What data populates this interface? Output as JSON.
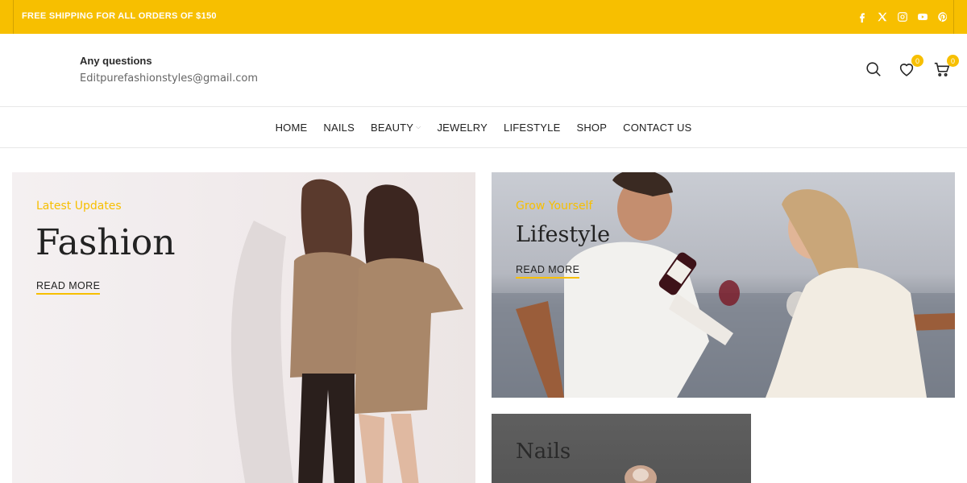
{
  "topbar": {
    "shipping_text": "FREE SHIPPING FOR ALL ORDERS OF $150",
    "bg_color": "#f7bf00",
    "socials": [
      "facebook-icon",
      "x-icon",
      "instagram-icon",
      "youtube-icon",
      "pinterest-icon"
    ]
  },
  "header": {
    "contact_label": "Any questions",
    "contact_email": "Editpurefashionstyles@gmail.com",
    "wishlist_count": "0",
    "cart_count": "0"
  },
  "nav": {
    "items": [
      {
        "label": "HOME"
      },
      {
        "label": "NAILS"
      },
      {
        "label": "BEAUTY",
        "has_dropdown": true
      },
      {
        "label": "JEWELRY"
      },
      {
        "label": "LIFESTYLE"
      },
      {
        "label": "SHOP"
      },
      {
        "label": "CONTACT US"
      }
    ]
  },
  "cards": {
    "fashion": {
      "eyebrow": "Latest Updates",
      "title": "Fashion",
      "cta": "READ MORE"
    },
    "lifestyle": {
      "eyebrow": "Grow Yourself",
      "title": "Lifestyle",
      "cta": "READ MORE"
    },
    "nails": {
      "title": "Nails"
    }
  },
  "colors": {
    "accent": "#f7bf00",
    "text": "#222222"
  }
}
